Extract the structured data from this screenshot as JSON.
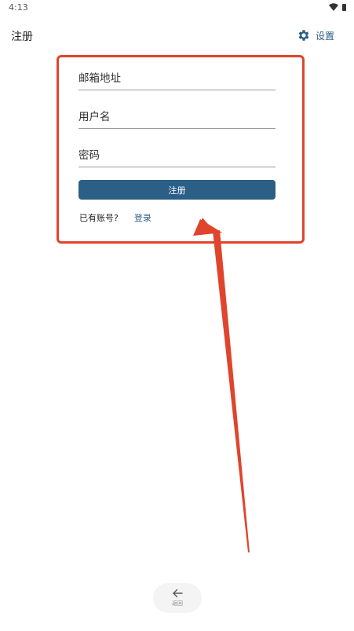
{
  "status_bar": {
    "time": "4:13"
  },
  "app_bar": {
    "title": "注册",
    "settings_label": "设置"
  },
  "form": {
    "email_placeholder": "邮箱地址",
    "username_placeholder": "用户名",
    "password_placeholder": "密码",
    "register_label": "注册",
    "have_account": "已有账号?",
    "login_label": "登录"
  },
  "nav": {
    "back_label": "返回"
  },
  "colors": {
    "accent": "#2c5f86",
    "annotation": "#e0442c"
  }
}
